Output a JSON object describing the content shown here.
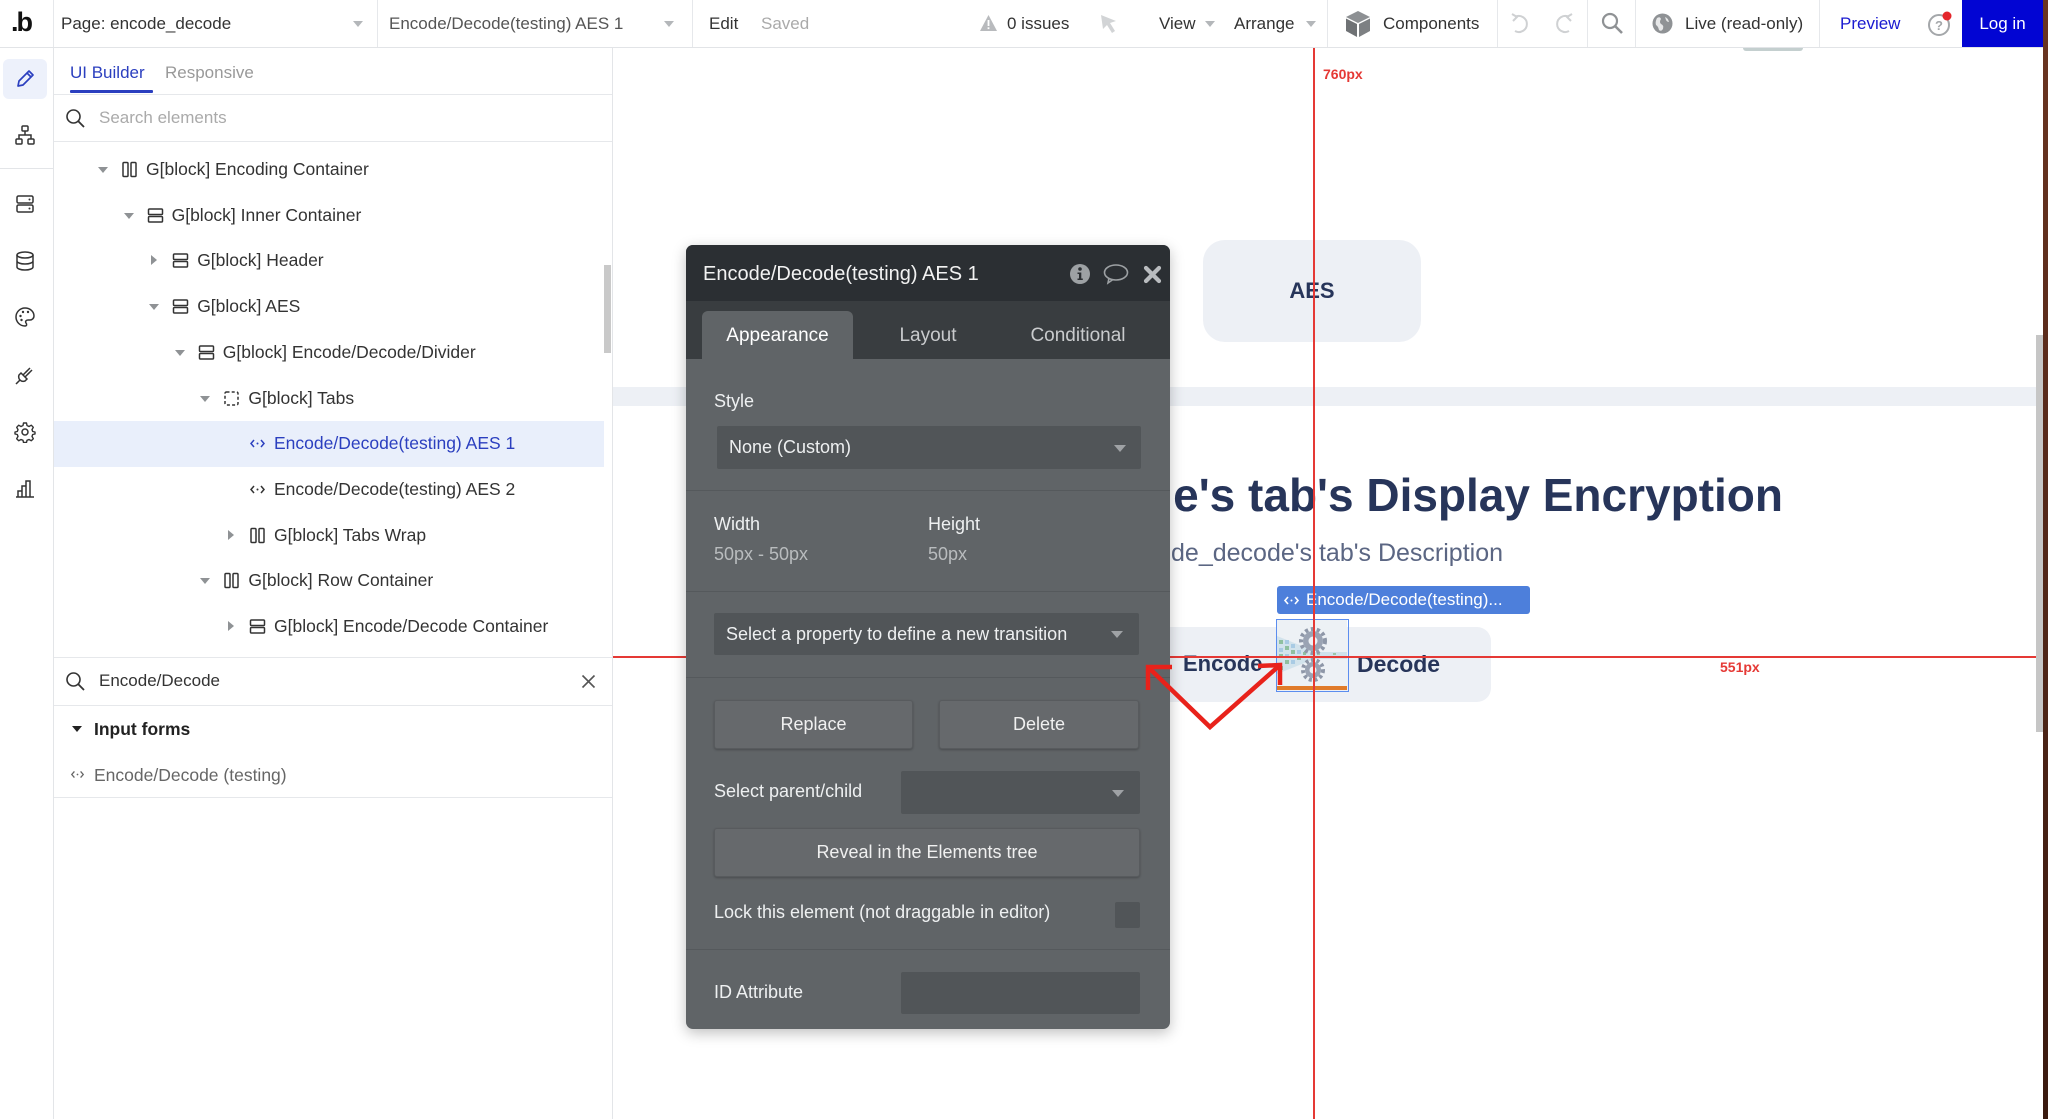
{
  "colors": {
    "accent": "#2b3fbf",
    "login": "#0205d3",
    "guide": "#e53935",
    "selection": "#4d7fdb",
    "ink": "#27355a"
  },
  "topbar": {
    "logo": ".b",
    "page_selector": "Page: encode_decode",
    "element_selector": "Encode/Decode(testing) AES 1",
    "edit": "Edit",
    "saved": "Saved",
    "issues": "0 issues",
    "view": "View",
    "arrange": "Arrange",
    "components": "Components",
    "live": "Live (read-only)",
    "preview": "Preview",
    "login": "Log in",
    "help_has_notification": true
  },
  "rail": {
    "items": [
      {
        "icon": "pencil-icon",
        "active": true
      },
      {
        "icon": "hierarchy-icon",
        "active": false
      },
      {
        "icon": "data-rows-icon",
        "active": false
      },
      {
        "icon": "database-icon",
        "active": false
      },
      {
        "icon": "palette-icon",
        "active": false
      },
      {
        "icon": "plug-icon",
        "active": false
      },
      {
        "icon": "gear-icon",
        "active": false
      },
      {
        "icon": "bar-chart-icon",
        "active": false
      }
    ]
  },
  "elements_panel": {
    "tabs": [
      {
        "label": "UI Builder",
        "active": true
      },
      {
        "label": "Responsive",
        "active": false
      }
    ],
    "search_placeholder": "Search elements",
    "tree": [
      {
        "label": "G[block] Encoding Container",
        "depth": 0,
        "state": "expanded",
        "icon": "column-layout-icon"
      },
      {
        "label": "G[block] Inner Container",
        "depth": 1,
        "state": "expanded",
        "icon": "row-layout-icon"
      },
      {
        "label": "G[block] Header",
        "depth": 2,
        "state": "collapsed",
        "icon": "row-layout-icon"
      },
      {
        "label": "G[block] AES",
        "depth": 2,
        "state": "expanded",
        "icon": "row-layout-icon"
      },
      {
        "label": "G[block] Encode/Decode/Divider",
        "depth": 3,
        "state": "expanded",
        "icon": "row-layout-icon"
      },
      {
        "label": "G[block] Tabs",
        "depth": 4,
        "state": "expanded",
        "icon": "dashed-group-icon"
      },
      {
        "label": "Encode/Decode(testing) AES 1",
        "depth": 5,
        "state": "leaf",
        "icon": "reusable-element-icon",
        "selected": true
      },
      {
        "label": "Encode/Decode(testing) AES 2",
        "depth": 5,
        "state": "leaf",
        "icon": "reusable-element-icon"
      },
      {
        "label": "G[block] Tabs Wrap",
        "depth": 5,
        "state": "collapsed",
        "icon": "column-layout-icon"
      },
      {
        "label": "G[block] Row Container",
        "depth": 4,
        "state": "expanded",
        "icon": "column-layout-icon"
      },
      {
        "label": "G[block] Encode/Decode Container",
        "depth": 5,
        "state": "collapsed",
        "icon": "row-layout-icon"
      }
    ],
    "filter_search": {
      "value": "Encode/Decode"
    },
    "results_group": "Input forms",
    "results": [
      "Encode/Decode (testing)"
    ]
  },
  "property_editor": {
    "title": "Encode/Decode(testing) AES 1",
    "tabs": [
      {
        "label": "Appearance",
        "active": true
      },
      {
        "label": "Layout",
        "active": false
      },
      {
        "label": "Conditional",
        "active": false
      }
    ],
    "style_label": "Style",
    "style_value": "None (Custom)",
    "width_label": "Width",
    "width_value": "50px - 50px",
    "height_label": "Height",
    "height_value": "50px",
    "transition_placeholder": "Select a property to define a new transition",
    "replace": "Replace",
    "delete": "Delete",
    "parent_child_label": "Select parent/child",
    "parent_child_value": "",
    "reveal": "Reveal in the Elements tree",
    "lock_label": "Lock this element (not draggable in editor)",
    "lock_checked": false,
    "id_attribute_label": "ID Attribute",
    "id_attribute_value": ""
  },
  "canvas": {
    "guide_vertical_label": "760px",
    "guide_horizontal_label": "551px",
    "aes_button": "AES",
    "heading": "e's tab's Display Encryption",
    "description": "ode_decode's tab's Description",
    "selected_tag": "Encode/Decode(testing)...",
    "encode": "Encode",
    "decode": "Decode"
  }
}
